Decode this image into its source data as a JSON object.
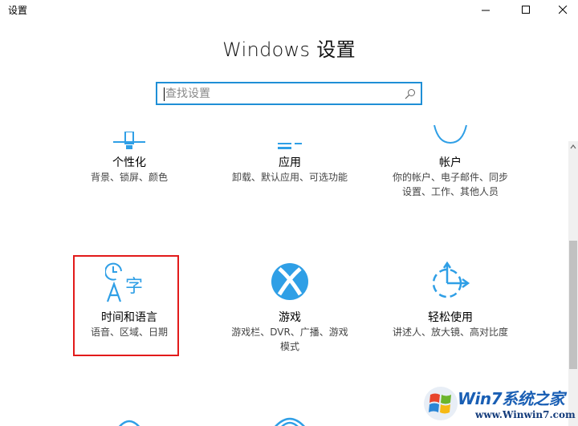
{
  "window": {
    "title": "设置"
  },
  "heading": "Windows 设置",
  "search": {
    "placeholder": "查找设置"
  },
  "tiles": [
    {
      "title": "个性化",
      "desc": "背景、锁屏、颜色",
      "icon": "personalization-icon"
    },
    {
      "title": "应用",
      "desc": "卸载、默认应用、可选功能",
      "icon": "apps-icon"
    },
    {
      "title": "帐户",
      "desc": "你的帐户、电子邮件、同步\n设置、工作、其他人员",
      "icon": "accounts-icon"
    },
    {
      "title": "时间和语言",
      "desc": "语音、区域、日期",
      "icon": "time-language-icon"
    },
    {
      "title": "游戏",
      "desc": "游戏栏、DVR、广播、游戏\n模式",
      "icon": "xbox-icon"
    },
    {
      "title": "轻松使用",
      "desc": "讲述人、放大镜、高对比度",
      "icon": "ease-of-access-icon"
    }
  ],
  "watermark": {
    "brand": "Win7系统之家",
    "url": "www.Winwin7.com"
  },
  "colors": {
    "accent": "#1f8fd6",
    "icon": "#2f9fe6",
    "selection": "#e21a1a"
  }
}
